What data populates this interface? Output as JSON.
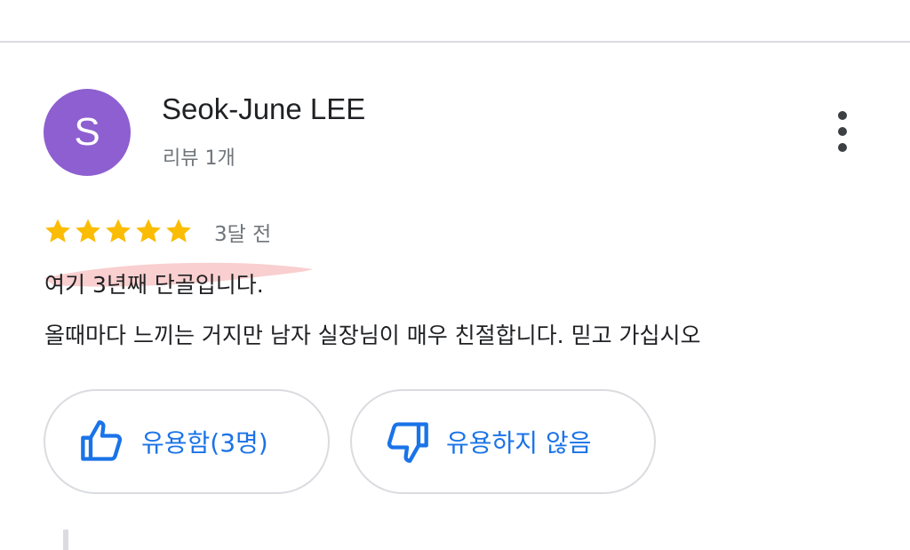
{
  "colors": {
    "avatar_bg": "#8e5fd0",
    "star": "#fbbc04",
    "accent": "#1a73e8",
    "highlight": "#f4a7a7"
  },
  "review": {
    "author": {
      "initial": "S",
      "name": "Seok-June LEE",
      "review_count": "리뷰 1개"
    },
    "rating": 5,
    "time": "3달 전",
    "text_lines": [
      "여기 3년째 단골입니다.",
      "올때마다 느끼는 거지만 남자 실장님이 매우 친절합니다. 믿고 가십시오"
    ],
    "actions": {
      "helpful_label": "유용함(3명)",
      "not_helpful_label": "유용하지 않음"
    },
    "icons": {
      "more": "more-vert-icon",
      "helpful": "thumbs-up-icon",
      "not_helpful": "thumbs-down-icon",
      "star": "star-icon"
    }
  }
}
